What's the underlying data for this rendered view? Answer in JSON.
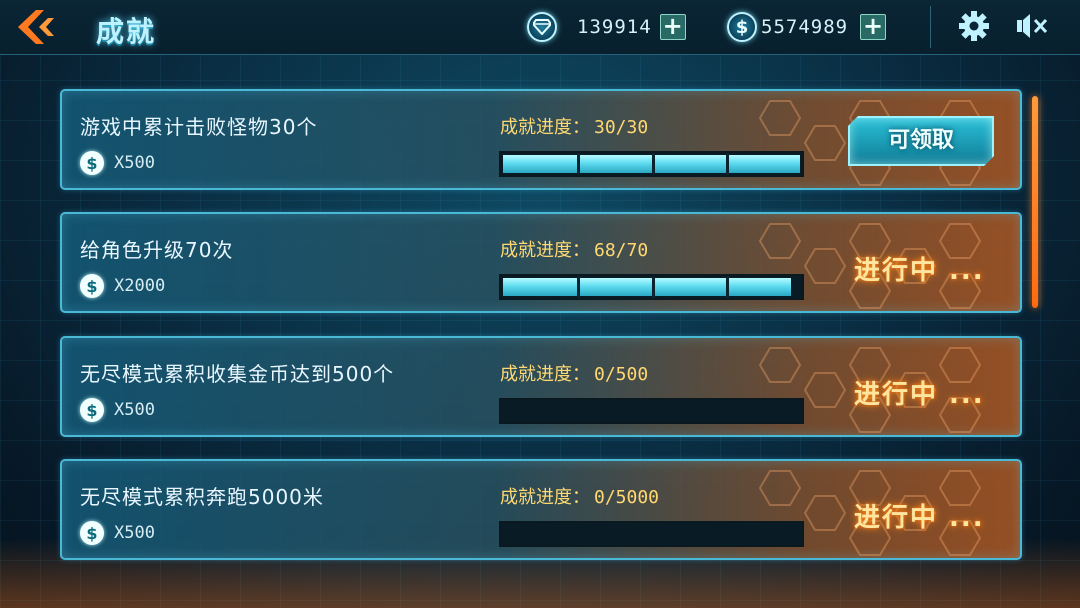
{
  "header": {
    "title": "成就",
    "gems": "139914",
    "coins": "5574989",
    "icons": {
      "back": "back-chevron-icon",
      "gem": "diamond-icon",
      "coin": "dollar-coin-icon",
      "plus": "plus-icon",
      "settings": "gear-icon",
      "sound": "mute-icon"
    }
  },
  "progress_label": "成就进度：",
  "achievements": [
    {
      "name": "游戏中累计击败怪物30个",
      "reward": "X500",
      "progress": "30/30",
      "fraction": 1.0,
      "action": "可领取",
      "state": "claimable"
    },
    {
      "name": "给角色升级70次",
      "reward": "X2000",
      "progress": "68/70",
      "fraction": 0.971,
      "action": "进行中 ...",
      "state": "in-progress"
    },
    {
      "name": "无尽模式累积收集金币达到500个",
      "reward": "X500",
      "progress": "0/500",
      "fraction": 0,
      "action": "进行中 ...",
      "state": "in-progress"
    },
    {
      "name": "无尽模式累积奔跑5000米",
      "reward": "X500",
      "progress": "0/5000",
      "fraction": 0,
      "action": "进行中 ...",
      "state": "in-progress"
    }
  ],
  "colors": {
    "accent": "#49b9d6",
    "status_orange": "#ff8a1a",
    "progress_text": "#ffd871"
  }
}
